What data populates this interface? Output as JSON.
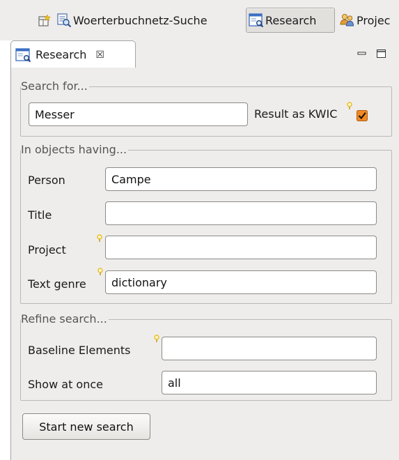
{
  "perspectives": {
    "items": [
      {
        "label": "Woerterbuchnetz-Suche",
        "icon": "dictionary-search-icon",
        "active": false
      },
      {
        "label": "Research",
        "icon": "research-view-icon",
        "active": true
      },
      {
        "label": "Projec",
        "icon": "project-users-icon",
        "active": false
      }
    ],
    "open_icon": "open-perspective-icon"
  },
  "view": {
    "tab_label": "Research",
    "tab_icon": "research-view-icon",
    "close_glyph": "☒",
    "minimize_icon": "minimize-icon",
    "maximize_icon": "maximize-icon"
  },
  "search_group": {
    "legend": "Search for...",
    "query_value": "Messer",
    "kwic_label": "Result as KWIC",
    "kwic_checked": true
  },
  "objects_group": {
    "legend": "In objects having...",
    "fields": [
      {
        "label": "Person",
        "value": "Campe",
        "hint": false
      },
      {
        "label": "Title",
        "value": "",
        "hint": false
      },
      {
        "label": "Project",
        "value": "",
        "hint": true
      },
      {
        "label": "Text genre",
        "value": "dictionary",
        "hint": true
      }
    ]
  },
  "refine_group": {
    "legend": "Refine search...",
    "fields": [
      {
        "label": "Baseline Elements",
        "value": "",
        "hint": true
      },
      {
        "label": "Show at once",
        "value": "all",
        "hint": false
      }
    ]
  },
  "actions": {
    "start_label": "Start new search"
  },
  "colors": {
    "background": "#eeedec",
    "accent_blue": "#3a6fc4",
    "checkbox_orange": "#f08a24",
    "hint_yellow": "#e8b400"
  }
}
